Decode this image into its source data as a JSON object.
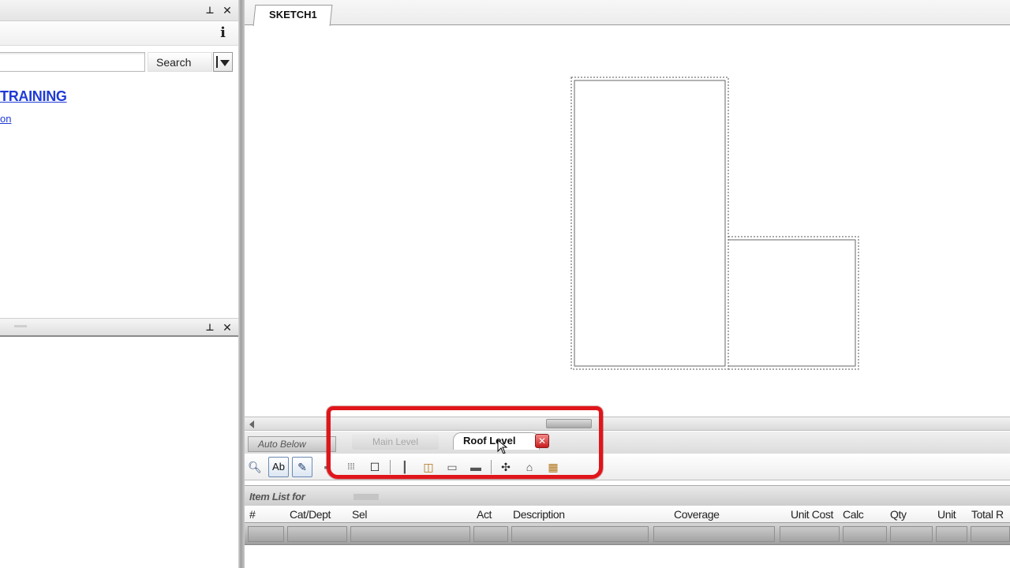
{
  "left_panel": {
    "search_button_label": "Search",
    "search_value": "",
    "training_link": "TRAINING",
    "partial_link": "on"
  },
  "sketch": {
    "tab_label": "SKETCH1"
  },
  "levels": {
    "auto_below": "Auto Below",
    "main_level": "Main Level",
    "roof_level": "Roof Level"
  },
  "toolbar": {
    "labeled_button": "Ab"
  },
  "item_list": {
    "title": "Item List for",
    "columns": [
      "#",
      "Cat/Dept",
      "Sel",
      "Act",
      "Description",
      "Coverage",
      "Unit Cost",
      "Calc",
      "Qty",
      "Unit",
      "Total R"
    ]
  },
  "colors": {
    "highlight_frame": "#e0151b",
    "link": "#1f3bd6"
  }
}
